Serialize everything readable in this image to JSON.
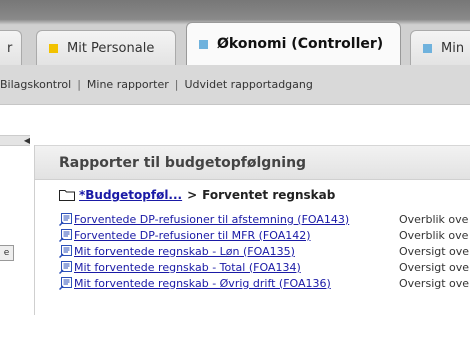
{
  "tabs": [
    {
      "label": "r",
      "color": "#5bb0e0",
      "active": false
    },
    {
      "label": "Mit Personale",
      "color": "#f2c200",
      "active": false
    },
    {
      "label": "Økonomi (Controller)",
      "color": "#6fb2dd",
      "active": true
    },
    {
      "label": "Min",
      "color": "#6fb2dd",
      "active": false
    }
  ],
  "subnav": {
    "items": [
      "Bilagskontrol",
      "Mine rapporter",
      "Udvidet rapportadgang"
    ],
    "separator": "|"
  },
  "panel": {
    "title": "Rapporter til budgetopfølgning",
    "breadcrumb": {
      "link": "*Budgetopføl...",
      "arrow": ">",
      "current": "Forventet regnskab"
    },
    "reports": [
      {
        "link": "Forventede DP-refusioner til afstemning (FOA143)",
        "desc": "Overblik ove"
      },
      {
        "link": "Forventede DP-refusioner til MFR (FOA142)",
        "desc": "Overblik ove"
      },
      {
        "link": "Mit forventede regnskab - Løn (FOA135)",
        "desc": "Oversigt ove"
      },
      {
        "link": "Mit forventede regnskab - Total (FOA134)",
        "desc": "Oversigt ove"
      },
      {
        "link": "Mit forventede regnskab - Øvrig drift (FOA136)",
        "desc": "Oversigt ove"
      }
    ]
  },
  "left_box_label": "e",
  "colors": {
    "link": "#1a1aa6",
    "icon_blue": "#2b4fb8"
  }
}
